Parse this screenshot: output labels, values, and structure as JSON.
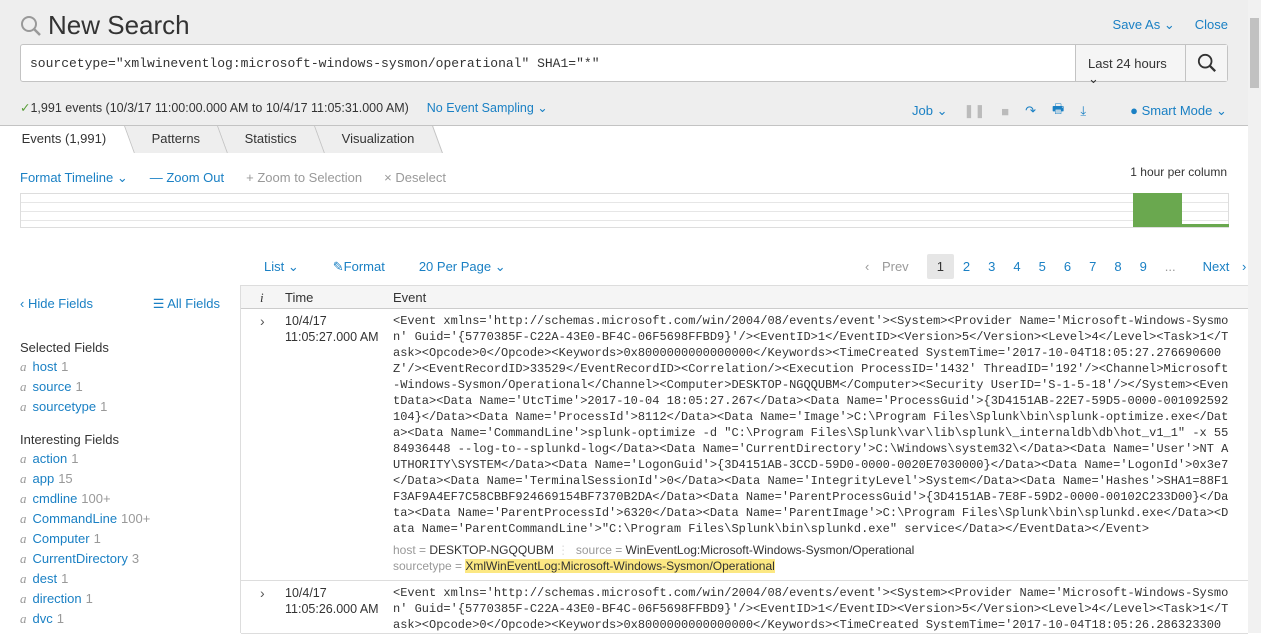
{
  "header": {
    "title": "New Search",
    "save_as": "Save As",
    "close": "Close"
  },
  "search": {
    "query": "sourcetype=\"xmlwineventlog:microsoft-windows-sysmon/operational\" SHA1=\"*\"",
    "time_range": "Last 24 hours"
  },
  "status": {
    "summary": "1,991 events (10/3/17 11:00:00.000 AM to 10/4/17 11:05:31.000 AM)",
    "sampling": "No Event Sampling",
    "job": "Job",
    "mode": "Smart Mode"
  },
  "tabs": [
    {
      "label": "Events (1,991)"
    },
    {
      "label": "Patterns"
    },
    {
      "label": "Statistics"
    },
    {
      "label": "Visualization"
    }
  ],
  "timeline": {
    "format": "Format Timeline",
    "zoom_out": "Zoom Out",
    "zoom_sel": "Zoom to Selection",
    "deselect": "Deselect",
    "scale": "1 hour per column",
    "colors": {
      "bar": "#6aa84f"
    }
  },
  "results_toolbar": {
    "list": "List",
    "format": "Format",
    "per_page": "20 Per Page"
  },
  "pager": {
    "prev": "Prev",
    "pages": [
      "1",
      "2",
      "3",
      "4",
      "5",
      "6",
      "7",
      "8",
      "9"
    ],
    "ellipsis": "...",
    "next": "Next",
    "current": "1"
  },
  "sidebar": {
    "hide": "Hide Fields",
    "all": "All Fields",
    "selected_title": "Selected Fields",
    "selected": [
      {
        "name": "host",
        "count": "1"
      },
      {
        "name": "source",
        "count": "1"
      },
      {
        "name": "sourcetype",
        "count": "1"
      }
    ],
    "interesting_title": "Interesting Fields",
    "interesting": [
      {
        "name": "action",
        "count": "1"
      },
      {
        "name": "app",
        "count": "15"
      },
      {
        "name": "cmdline",
        "count": "100+"
      },
      {
        "name": "CommandLine",
        "count": "100+"
      },
      {
        "name": "Computer",
        "count": "1"
      },
      {
        "name": "CurrentDirectory",
        "count": "3"
      },
      {
        "name": "dest",
        "count": "1"
      },
      {
        "name": "direction",
        "count": "1"
      },
      {
        "name": "dvc",
        "count": "1"
      }
    ],
    "type_glyph": "a"
  },
  "table": {
    "col_i": "i",
    "col_time": "Time",
    "col_event": "Event"
  },
  "events": [
    {
      "date": "10/4/17",
      "time": "11:05:27.000 AM",
      "lines": [
        "<Event xmlns='http://schemas.microsoft.com/win/2004/08/events/event'><System><Provider Name='Microsoft-Windows-Sysmo",
        "n' Guid='{5770385F-C22A-43E0-BF4C-06F5698FFBD9}'/><EventID>1</EventID><Version>5</Version><Level>4</Level><Task>1</T",
        "ask><Opcode>0</Opcode><Keywords>0x8000000000000000</Keywords><TimeCreated SystemTime='2017-10-04T18:05:27.276690600",
        "Z'/><EventRecordID>33529</EventRecordID><Correlation/><Execution ProcessID='1432' ThreadID='192'/><Channel>Microsoft",
        "-Windows-Sysmon/Operational</Channel><Computer>DESKTOP-NGQQUBM</Computer><Security UserID='S-1-5-18'/></System><Even",
        "tData><Data Name='UtcTime'>2017-10-04 18:05:27.267</Data><Data Name='ProcessGuid'>{3D4151AB-22E7-59D5-0000-001092592",
        "104}</Data><Data Name='ProcessId'>8112</Data><Data Name='Image'>C:\\Program Files\\Splunk\\bin\\splunk-optimize.exe</Dat",
        "a><Data Name='CommandLine'>splunk-optimize -d \"C:\\Program Files\\Splunk\\var\\lib\\splunk\\_internaldb\\db\\hot_v1_1\" -x 55",
        "84936448 --log-to--splunkd-log</Data><Data Name='CurrentDirectory'>C:\\Windows\\system32\\</Data><Data Name='User'>NT A",
        "UTHORITY\\SYSTEM</Data><Data Name='LogonGuid'>{3D4151AB-3CCD-59D0-0000-0020E7030000}</Data><Data Name='LogonId'>0x3e7",
        "</Data><Data Name='TerminalSessionId'>0</Data><Data Name='IntegrityLevel'>System</Data><Data Name='Hashes'>SHA1=88F1",
        "F3AF9A4EF7C58CBBF924669154BF7370B2DA</Data><Data Name='ParentProcessGuid'>{3D4151AB-7E8F-59D2-0000-00102C233D00}</Da",
        "ta><Data Name='ParentProcessId'>6320</Data><Data Name='ParentImage'>C:\\Program Files\\Splunk\\bin\\splunkd.exe</Data><D",
        "ata Name='ParentCommandLine'>\"C:\\Program Files\\Splunk\\bin\\splunkd.exe\" service</Data></EventData></Event>"
      ],
      "host": "DESKTOP-NGQQUBM",
      "source": "WinEventLog:Microsoft-Windows-Sysmon/Operational",
      "sourcetype": "XmlWinEventLog:Microsoft-Windows-Sysmon/Operational"
    },
    {
      "date": "10/4/17",
      "time": "11:05:26.000 AM",
      "lines": [
        "<Event xmlns='http://schemas.microsoft.com/win/2004/08/events/event'><System><Provider Name='Microsoft-Windows-Sysmo",
        "n' Guid='{5770385F-C22A-43E0-BF4C-06F5698FFBD9}'/><EventID>1</EventID><Version>5</Version><Level>4</Level><Task>1</T",
        "ask><Opcode>0</Opcode><Keywords>0x8000000000000000</Keywords><TimeCreated SystemTime='2017-10-04T18:05:26.286323300"
      ]
    }
  ],
  "meta_labels": {
    "host": "host = ",
    "source": "source = ",
    "sourcetype": "sourcetype = "
  }
}
